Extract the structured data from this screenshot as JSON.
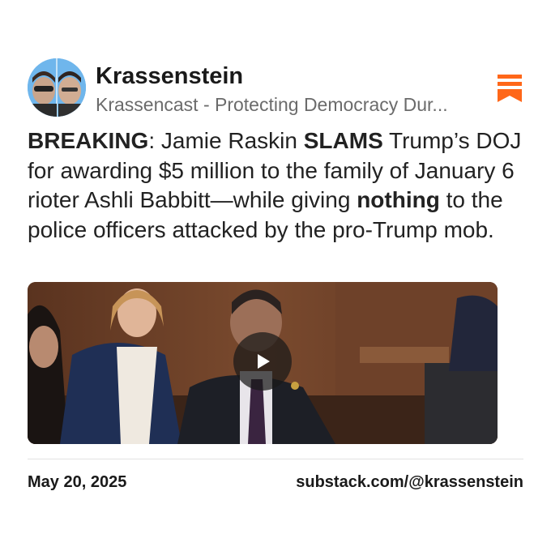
{
  "header": {
    "author": "Krassenstein",
    "publication": "Krassencast - Protecting Democracy Dur..."
  },
  "post": {
    "segments": [
      {
        "text": "BREAKING",
        "bold": true
      },
      {
        "text": ": Jamie Raskin ",
        "bold": false
      },
      {
        "text": "SLAMS",
        "bold": true
      },
      {
        "text": " Trump’s DOJ for awarding $5 million to the family of January 6 rioter Ashli Babbitt—while giving ",
        "bold": false
      },
      {
        "text": "nothing",
        "bold": true
      },
      {
        "text": " to the police officers attacked by the pro-Trump mob.",
        "bold": false
      }
    ]
  },
  "footer": {
    "date": "May 20, 2025",
    "link": "substack.com/@krassenstein"
  },
  "colors": {
    "accent": "#ff6719",
    "text": "#1a1a1a",
    "muted": "#6b6b6b"
  },
  "icons": {
    "bookmark": "bookmark-icon",
    "play": "play-icon"
  }
}
